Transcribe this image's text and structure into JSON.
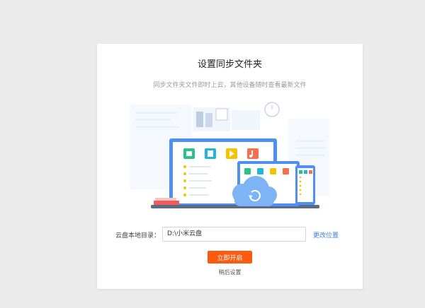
{
  "dialog": {
    "title": "设置同步文件夹",
    "subtitle": "同步文件夹文件即时上云，其他设备随时查看最新文件",
    "local_dir_label": "云盘本地目录：",
    "local_dir_value": "D:\\小米云盘",
    "change_location_label": "更改位置",
    "start_button_label": "立即开启",
    "later_label": "稍后设置"
  },
  "colors": {
    "accent": "#fb5a0f",
    "link": "#3f7fd6",
    "background": "#ebebeb"
  },
  "icons": [
    "image-icon",
    "document-icon",
    "video-icon",
    "music-icon",
    "cloud-sync-icon"
  ]
}
